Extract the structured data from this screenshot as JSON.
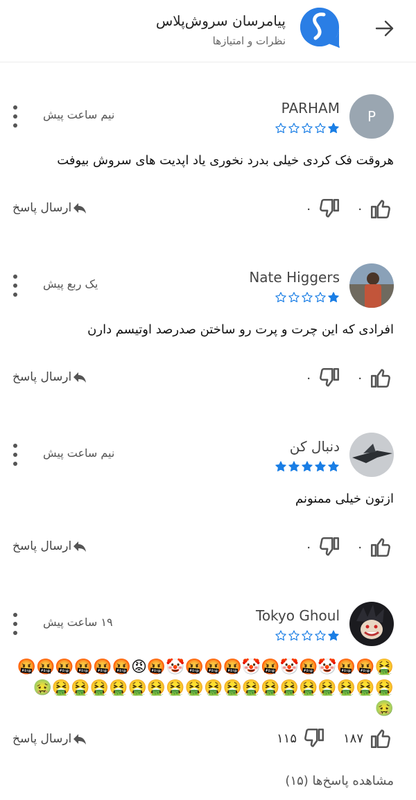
{
  "header": {
    "title": "پیامرسان سروش‌پلاس",
    "subtitle": "نظرات و امتیازها",
    "back_icon": "arrow-right-icon",
    "logo_icon": "soroush-logo-icon",
    "accent_color": "#2a7ee5"
  },
  "reviews": [
    {
      "name": "PARHAM",
      "avatar_letter": "P",
      "rating": 1,
      "time": "نیم ساعت پیش",
      "text": "هروقت فک کردی خیلی بدرد نخوری یاد اپدیت های سروش بیوفت",
      "likes": "۰",
      "dislikes": "۰",
      "reply_label": "ارسال پاسخ"
    },
    {
      "name": "Nate Higgers",
      "rating": 1,
      "time": "یک ربع پیش",
      "text": "افرادی که این چرت و پرت رو ساختن صدرصد اوتیسم دارن",
      "likes": "۰",
      "dislikes": "۰",
      "reply_label": "ارسال پاسخ"
    },
    {
      "name": "دنبال کن",
      "rating": 5,
      "time": "نیم ساعت پیش",
      "text": "ازتون خیلی ممنونم",
      "likes": "۰",
      "dislikes": "۰",
      "reply_label": "ارسال پاسخ"
    },
    {
      "name": "Tokyo Ghoul",
      "rating": 1,
      "time": "۱۹ ساعت پیش",
      "text_line1": "🤮🤬🤬🤡🤬🤡🤬🤡🤬🤬🤬🤡🤬😡🤬🤬🤬🤬🤬🤬",
      "text_line2": "🤮🤮🤮🤮🤮🤮🤮🤮🤮🤮🤮🤮🤮🤮🤮🤮🤮🤮🤢🤢",
      "likes": "۱۸۷",
      "dislikes": "۱۱۵",
      "reply_label": "ارسال پاسخ"
    }
  ],
  "view_replies": "مشاهده پاسخ‌ها (۱۵)",
  "colors": {
    "star": "#1a7ee5",
    "icon": "#555555",
    "avatar_bg": "#9aa6b1"
  }
}
